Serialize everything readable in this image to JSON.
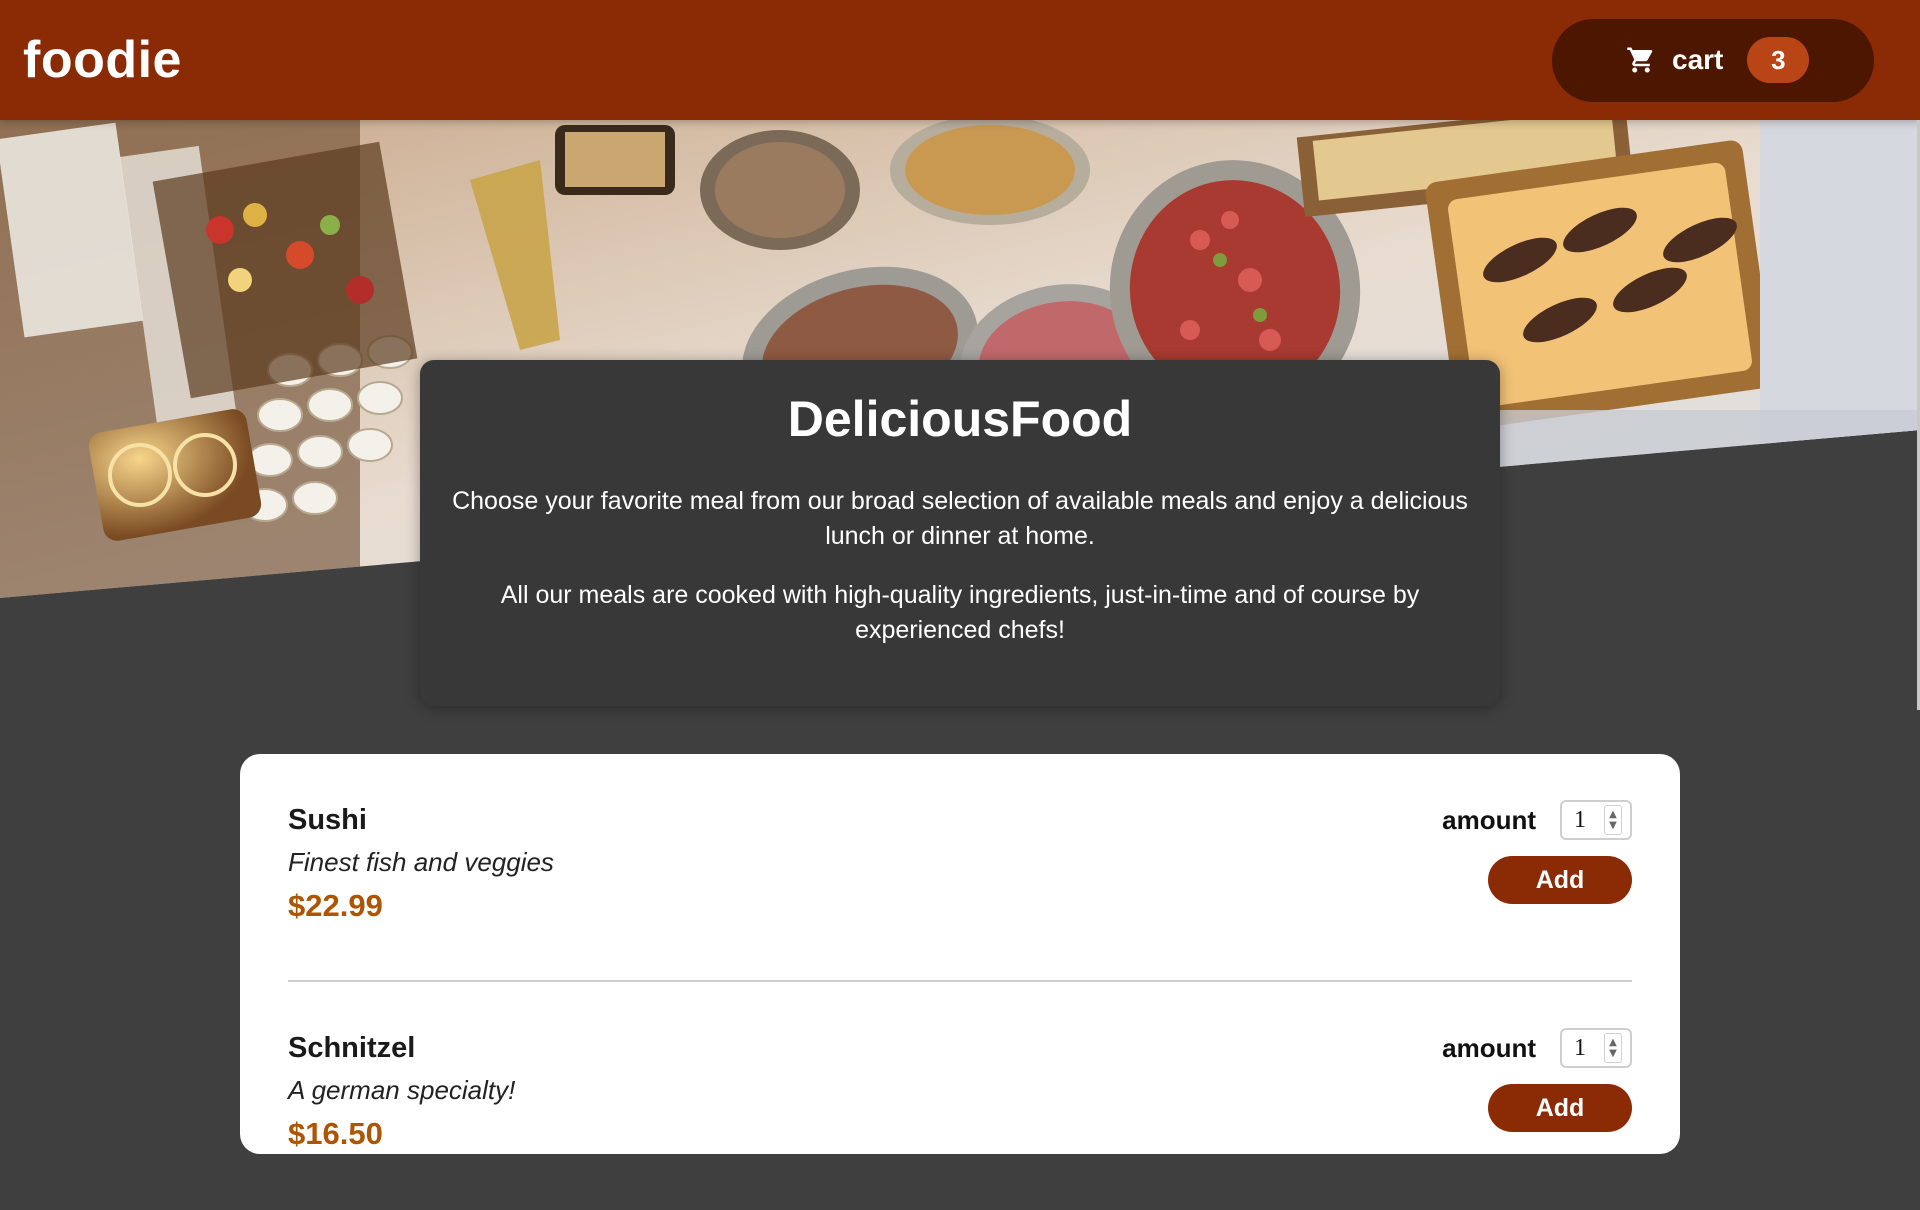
{
  "header": {
    "logo": "foodie",
    "cart_label": "cart",
    "cart_count": "3",
    "cart_icon": "cart-icon"
  },
  "banner": {
    "image_description": "buffet-table-photo"
  },
  "summary": {
    "title": "DeliciousFood",
    "paragraph1": "Choose your favorite meal from our broad selection of available meals and enjoy a delicious lunch or dinner at home.",
    "paragraph2": "All our meals are cooked with high-quality ingredients, just-in-time and of course by experienced chefs!"
  },
  "meals": [
    {
      "name": "Sushi",
      "description": "Finest fish and veggies",
      "price": "$22.99",
      "amount_label": "amount",
      "amount_value": "1",
      "add_label": "Add"
    },
    {
      "name": "Schnitzel",
      "description": "A german specialty!",
      "price": "$16.50",
      "amount_label": "amount",
      "amount_value": "1",
      "add_label": "Add"
    }
  ],
  "colors": {
    "header_bg": "#8a2b06",
    "cart_bg": "#4d1601",
    "badge_bg": "#b94517",
    "price": "#ad5502",
    "page_bg": "#3f3f3f"
  }
}
